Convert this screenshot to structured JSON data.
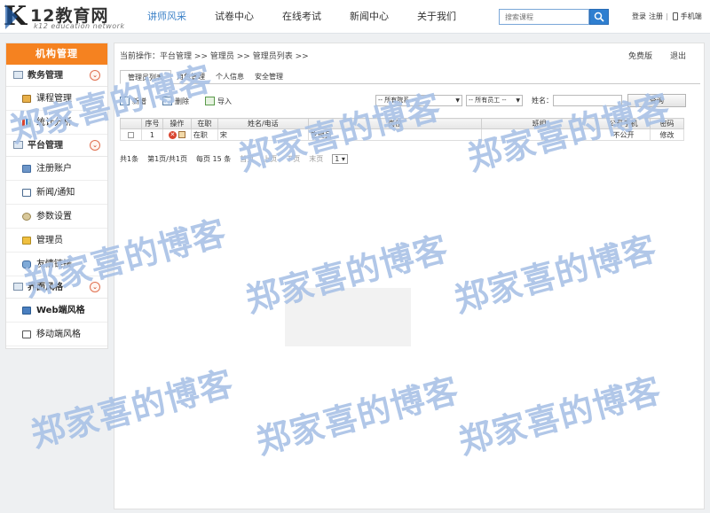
{
  "logo": {
    "brand": "12教育网",
    "subtitle": "k12 education network"
  },
  "nav": {
    "items": [
      "讲师风采",
      "试卷中心",
      "在线考试",
      "新闻中心",
      "关于我们"
    ],
    "active_index": 0
  },
  "search": {
    "placeholder": "搜索课程"
  },
  "top_links": {
    "login": "登录",
    "register": "注册",
    "mobile": "手机端"
  },
  "sidebar": {
    "title": "机构管理",
    "groups": [
      {
        "label": "教务管理",
        "items": [
          "课程管理",
          "统计分析"
        ]
      },
      {
        "label": "平台管理",
        "items": [
          "注册账户",
          "新闻/通知",
          "参数设置",
          "管理员",
          "友情链接"
        ]
      },
      {
        "label": "界面风格",
        "items": [
          "Web端风格",
          "移动端风格"
        ]
      }
    ]
  },
  "breadcrumb": {
    "prefix": "当前操作：",
    "path": [
      "平台管理",
      "管理员",
      "管理员列表"
    ],
    "separator": ">>",
    "edition": "免费版",
    "logout": "退出"
  },
  "tabs": [
    "管理员列表",
    "角色管理",
    "个人信息",
    "安全管理"
  ],
  "toolbar": {
    "add": "新增",
    "delete": "删除",
    "import": "导入",
    "filter_school": "-- 所有院系 --",
    "filter_staff": "-- 所有员工 --",
    "name_label": "姓名：",
    "query": "查询"
  },
  "table": {
    "headers": [
      "",
      "序号",
      "操作",
      "在职",
      "姓名/电话",
      "岗位",
      "班组",
      "公开手机",
      "密码"
    ],
    "rows": [
      {
        "no": "1",
        "status": "在职",
        "name": "宋",
        "post": "管理员",
        "group": "",
        "phone_public": "不公开",
        "password": "修改"
      }
    ]
  },
  "pager": {
    "total": "共1条",
    "page_info": "第1页/共1页",
    "per_page": "每页 15 条",
    "first": "首页",
    "prev": "上页",
    "next": "下页",
    "last": "末页",
    "current": "1"
  },
  "watermark": "郑家喜的博客",
  "colors": {
    "accent": "#f58220",
    "nav_active": "#3d82c8",
    "search_button": "#2f7fd0",
    "watermark": "#a9c2e6"
  }
}
